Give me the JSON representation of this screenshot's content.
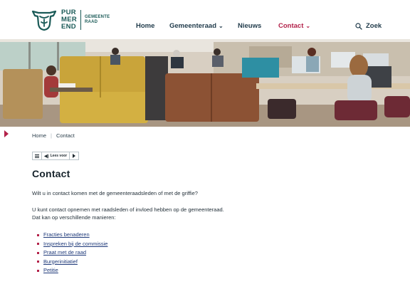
{
  "brand": {
    "line1": "PUR",
    "line2": "MER",
    "line3": "END",
    "sub1": "GEMEENTE",
    "sub2": "RAAD",
    "accent": "#b3224a",
    "primary": "#1a5a57"
  },
  "nav": {
    "items": [
      {
        "label": "Home",
        "has_dropdown": false,
        "active": false
      },
      {
        "label": "Gemeenteraad",
        "has_dropdown": true,
        "active": false
      },
      {
        "label": "Nieuws",
        "has_dropdown": false,
        "active": false
      },
      {
        "label": "Contact",
        "has_dropdown": true,
        "active": true
      }
    ],
    "search_label": "Zoek"
  },
  "breadcrumb": {
    "items": [
      "Home",
      "Contact"
    ]
  },
  "readspeaker": {
    "menu_icon": "menu-icon",
    "label": "Lees voor",
    "play_icon": "play-icon"
  },
  "page": {
    "title": "Contact",
    "intro": "Wilt u in contact komen met de gemeenteraadsleden of met de griffie?",
    "body_line1": "U kunt contact opnemen met raadsleden of invloed hebben op de gemeenteraad.",
    "body_line2": "Dat kan op verschillende manieren:",
    "links": [
      "Fracties benaderen",
      "Inspreken bij de commissie",
      "Praat met de raad",
      "Burgerinitiatief",
      "Petitie"
    ]
  }
}
